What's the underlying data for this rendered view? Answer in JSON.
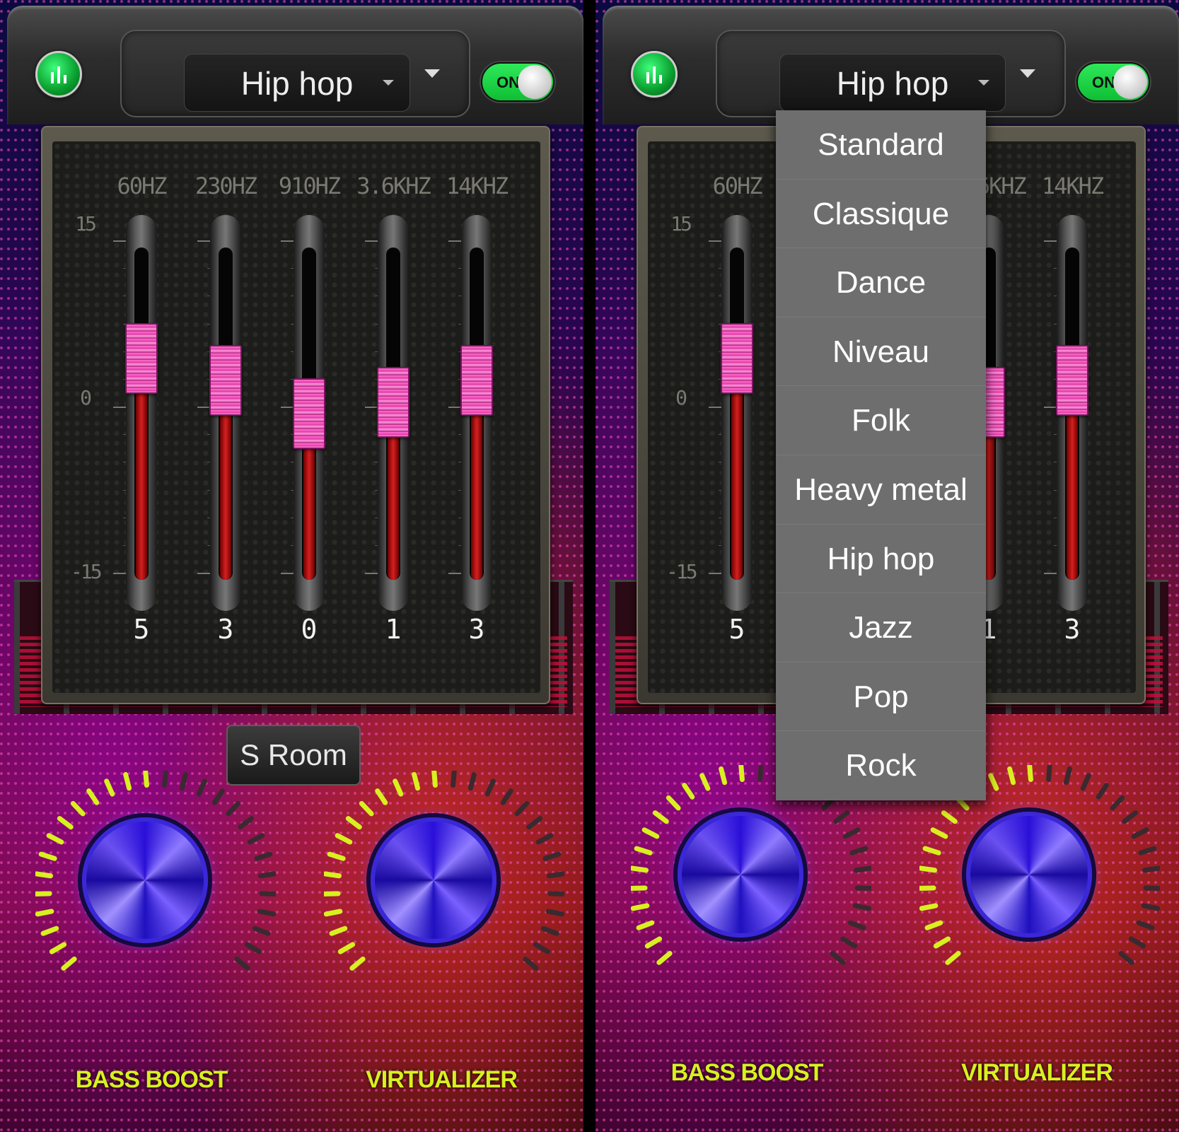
{
  "preset": {
    "selected": "Hip hop"
  },
  "power": {
    "label": "ON",
    "state": "on"
  },
  "bands": [
    {
      "freq": "60HZ",
      "value": "5",
      "level": 5
    },
    {
      "freq": "230HZ",
      "value": "3",
      "level": 3
    },
    {
      "freq": "910HZ",
      "value": "0",
      "level": 0
    },
    {
      "freq": "3.6KHZ",
      "value": "1",
      "level": 1
    },
    {
      "freq": "14KHZ",
      "value": "3",
      "level": 3
    }
  ],
  "scale": {
    "max": "15",
    "mid": "0",
    "min": "-15"
  },
  "reverb": {
    "label": "S Room"
  },
  "knobs": {
    "bass": "BASS BOOST",
    "virtualizer": "VIRTUALIZER"
  },
  "dropdown": {
    "items": [
      "Standard",
      "Classique",
      "Dance",
      "Niveau",
      "Folk",
      "Heavy metal",
      "Hip hop",
      "Jazz",
      "Pop",
      "Rock"
    ]
  },
  "icons": {
    "logo": "equalizer-icon",
    "caret": "caret-down-icon"
  },
  "colors": {
    "toggle_on": "#1bd447",
    "slider_thumb": "#e23ca6",
    "knob": "#3a28d8",
    "knob_ticks": "#d8f020"
  }
}
